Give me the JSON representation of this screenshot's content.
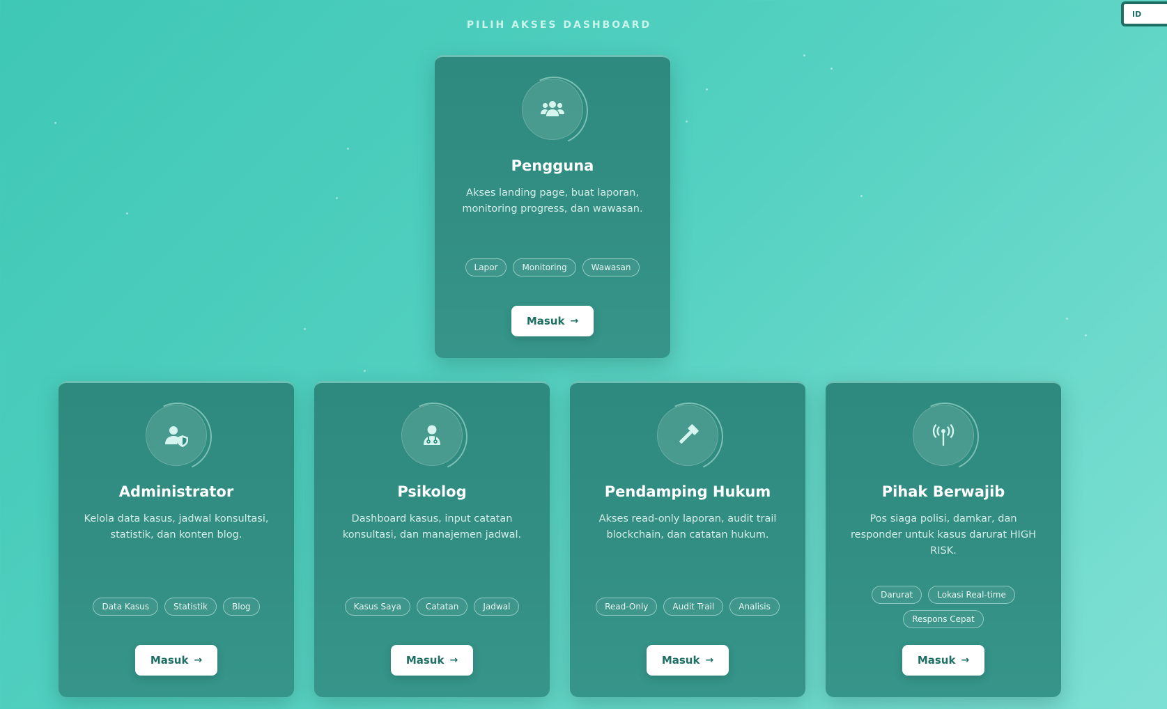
{
  "heading": "PILIH AKSES DASHBOARD",
  "language": "ID",
  "colors": {
    "card": "#2e8a7e",
    "accent": "#1f6f65",
    "background": "#4ccbbb"
  },
  "cards": [
    {
      "icon": "users-icon",
      "title": "Pengguna",
      "description": "Akses landing page, buat laporan, monitoring progress, dan wawasan.",
      "tags": [
        "Lapor",
        "Monitoring",
        "Wawasan"
      ],
      "button": "Masuk"
    },
    {
      "icon": "user-shield-icon",
      "title": "Administrator",
      "description": "Kelola data kasus, jadwal konsultasi, statistik, dan konten blog.",
      "tags": [
        "Data Kasus",
        "Statistik",
        "Blog"
      ],
      "button": "Masuk"
    },
    {
      "icon": "user-doctor-icon",
      "title": "Psikolog",
      "description": "Dashboard kasus, input catatan konsultasi, dan manajemen jadwal.",
      "tags": [
        "Kasus Saya",
        "Catatan",
        "Jadwal"
      ],
      "button": "Masuk"
    },
    {
      "icon": "gavel-icon",
      "title": "Pendamping Hukum",
      "description": "Akses read-only laporan, audit trail blockchain, dan catatan hukum.",
      "tags": [
        "Read-Only",
        "Audit Trail",
        "Analisis"
      ],
      "button": "Masuk"
    },
    {
      "icon": "broadcast-tower-icon",
      "title": "Pihak Berwajib",
      "description": "Pos siaga polisi, damkar, dan responder untuk kasus darurat HIGH RISK.",
      "tags": [
        "Darurat",
        "Lokasi Real-time",
        "Respons Cepat"
      ],
      "button": "Masuk"
    }
  ]
}
